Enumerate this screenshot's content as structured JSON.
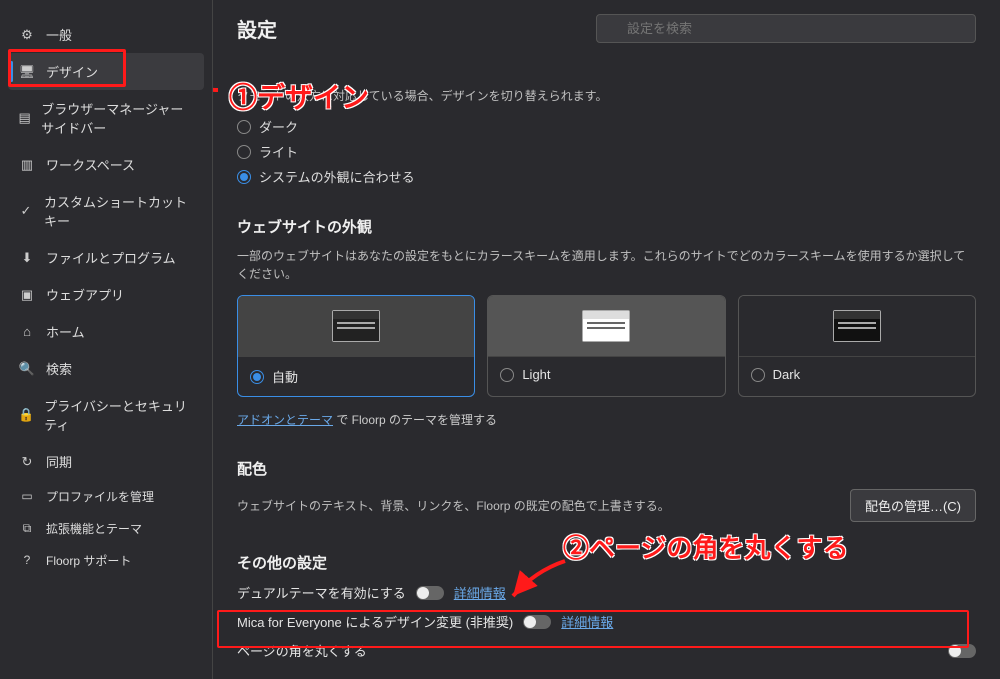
{
  "page_title": "設定",
  "search_placeholder": "設定を検索",
  "sidebar": {
    "items": [
      {
        "label": "一般",
        "icon": "gear"
      },
      {
        "label": "デザイン",
        "icon": "design",
        "active": true
      },
      {
        "label": "ブラウザーマネージャーサイドバー",
        "icon": "panel"
      },
      {
        "label": "ワークスペース",
        "icon": "workspace"
      },
      {
        "label": "カスタムショートカットキー",
        "icon": "check"
      },
      {
        "label": "ファイルとプログラム",
        "icon": "download"
      },
      {
        "label": "ウェブアプリ",
        "icon": "webapp"
      },
      {
        "label": "ホーム",
        "icon": "home"
      },
      {
        "label": "検索",
        "icon": "search"
      },
      {
        "label": "プライバシーとセキュリティ",
        "icon": "lock"
      },
      {
        "label": "同期",
        "icon": "sync"
      }
    ],
    "bottom": [
      {
        "label": "プロファイルを管理",
        "icon": "profile"
      },
      {
        "label": "拡張機能とテーマ",
        "icon": "extension"
      },
      {
        "label": "Floorp サポート",
        "icon": "help"
      }
    ]
  },
  "theme": {
    "desc_fragment": "クモートの双方に対応している場合、デザインを切り替えられます。",
    "options": [
      "ダーク",
      "ライト",
      "システムの外観に合わせる"
    ],
    "selected_index": 2
  },
  "website_appearance": {
    "title": "ウェブサイトの外観",
    "desc": "一部のウェブサイトはあなたの設定をもとにカラースキームを適用します。これらのサイトでどのカラースキームを使用するか選択してください。",
    "schemes": [
      {
        "label": "自動",
        "selected": true
      },
      {
        "label": "Light",
        "selected": false
      },
      {
        "label": "Dark",
        "selected": false
      }
    ],
    "addon_link_text": "アドオンとテーマ",
    "addon_suffix": " で Floorp のテーマを管理する"
  },
  "palette": {
    "title": "配色",
    "desc": "ウェブサイトのテキスト、背景、リンクを、Floorp の既定の配色で上書きする。",
    "button": "配色の管理…(C)"
  },
  "misc": {
    "title": "その他の設定",
    "dual_theme_label": "デュアルテーマを有効にする",
    "mica_label": "Mica for Everyone によるデザイン変更 (非推奨)",
    "round_corner_label": "ページの角を丸くする",
    "detail_link": "詳細情報"
  },
  "annotations": {
    "one": "①デザイン",
    "two": "②ページの角を丸くする"
  }
}
